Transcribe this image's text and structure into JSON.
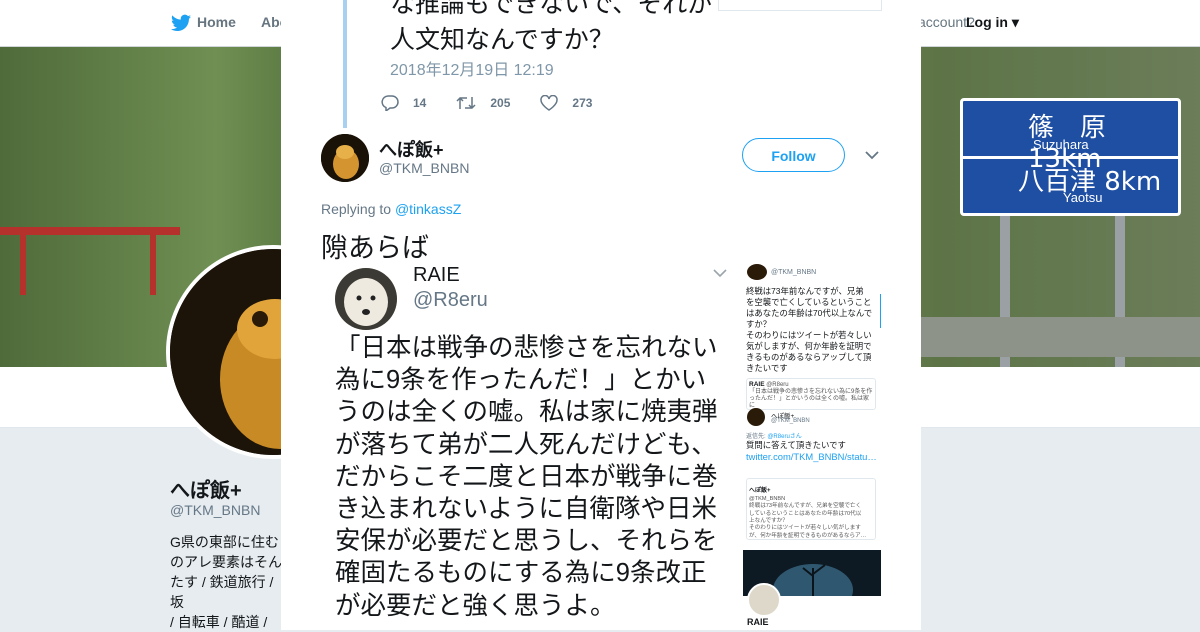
{
  "background": {
    "nav": {
      "home": "Home",
      "about": "Abo",
      "account_prompt": "account?",
      "login": "Log in"
    },
    "profile": {
      "name": "へぽ飯+",
      "handle": "@TKM_BNBN",
      "bio": "G県の東部に住む\nのアレ要素はそん\nたす / 鉄道旅行 / 坂\n/ 自転車 / 酷道 / 共\nローされたら大抵"
    },
    "sign": {
      "line1": "篠　原13km",
      "line1_sub": "Suzuhara",
      "line2": "八百津 8km",
      "line2_sub": "Yaotsu"
    }
  },
  "modal": {
    "quoted": {
      "text": "な推論もできないで、それが\n人文知なんですか？",
      "date": "2018年12月19日 12:19",
      "replies": "14",
      "retweets": "205",
      "likes": "273"
    },
    "tweet": {
      "name": "へぽ飯+",
      "handle": "@TKM_BNBN",
      "follow_label": "Follow",
      "replying_label": "Replying to",
      "replying_mention": "@tinkassZ",
      "text": "隙あらば"
    },
    "image1": {
      "name": "RAIE",
      "handle": "@R8eru",
      "body": "「日本は戦争の悲惨さを忘れない\n為に9条を作ったんだ！」とかい\nうのは全くの嘘。私は家に焼夷弾\nが落ちて弟が二人死んだけども、\nだからこそ二度と日本が戦争に巻\nき込まれないように自衛隊や日米\n安保が必要だと思うし、それらを\n確固たるものにする為に9条改正\nが必要だと強く思うよ。"
    },
    "image2": {
      "handle_top": "@TKM_BNBN",
      "body": "終戦は73年前なんですが、兄弟\nを空襲で亡くしているということ\nはあなたの年齢は70代以上なんで\nすか？\nそのわりにはツイートが若々しい\n気がしますが、何か年齢を証明で\nきるものがあるならアップして頂\nきたいです",
      "quote_name": "RAIE",
      "quote_handle": "@R8eru",
      "quote_text": "「日本は戦争の悲惨さを忘れない為に9条を作ったんだ！」とかいうのは全くの嘘。私は家に",
      "reply_name": "へぽ飯+",
      "reply_handle": "@TKM_BNBN",
      "reply_label": "返信先:",
      "reply_mention": "@R8eruさん",
      "reply_text": "質問に答えて頂きたいです",
      "reply_link": "twitter.com/TKM_BNBN/statu…",
      "quote2_name": "へぽ飯+",
      "quote2_handle": "@TKM_BNBN",
      "quote2_text": "終戦は73年前なんですが、兄弟を空襲で亡く\nしているということはあなたの年齢は70代以\n上なんですか？\nそのわりにはツイートが若々しい気がします\nが、何か年齢を証明できるものがあるならア…\nこのスレッドを表示",
      "last_name": "RAIE"
    }
  },
  "colors": {
    "accent": "#1da1f2",
    "text": "#14171a",
    "muted": "#657786"
  }
}
